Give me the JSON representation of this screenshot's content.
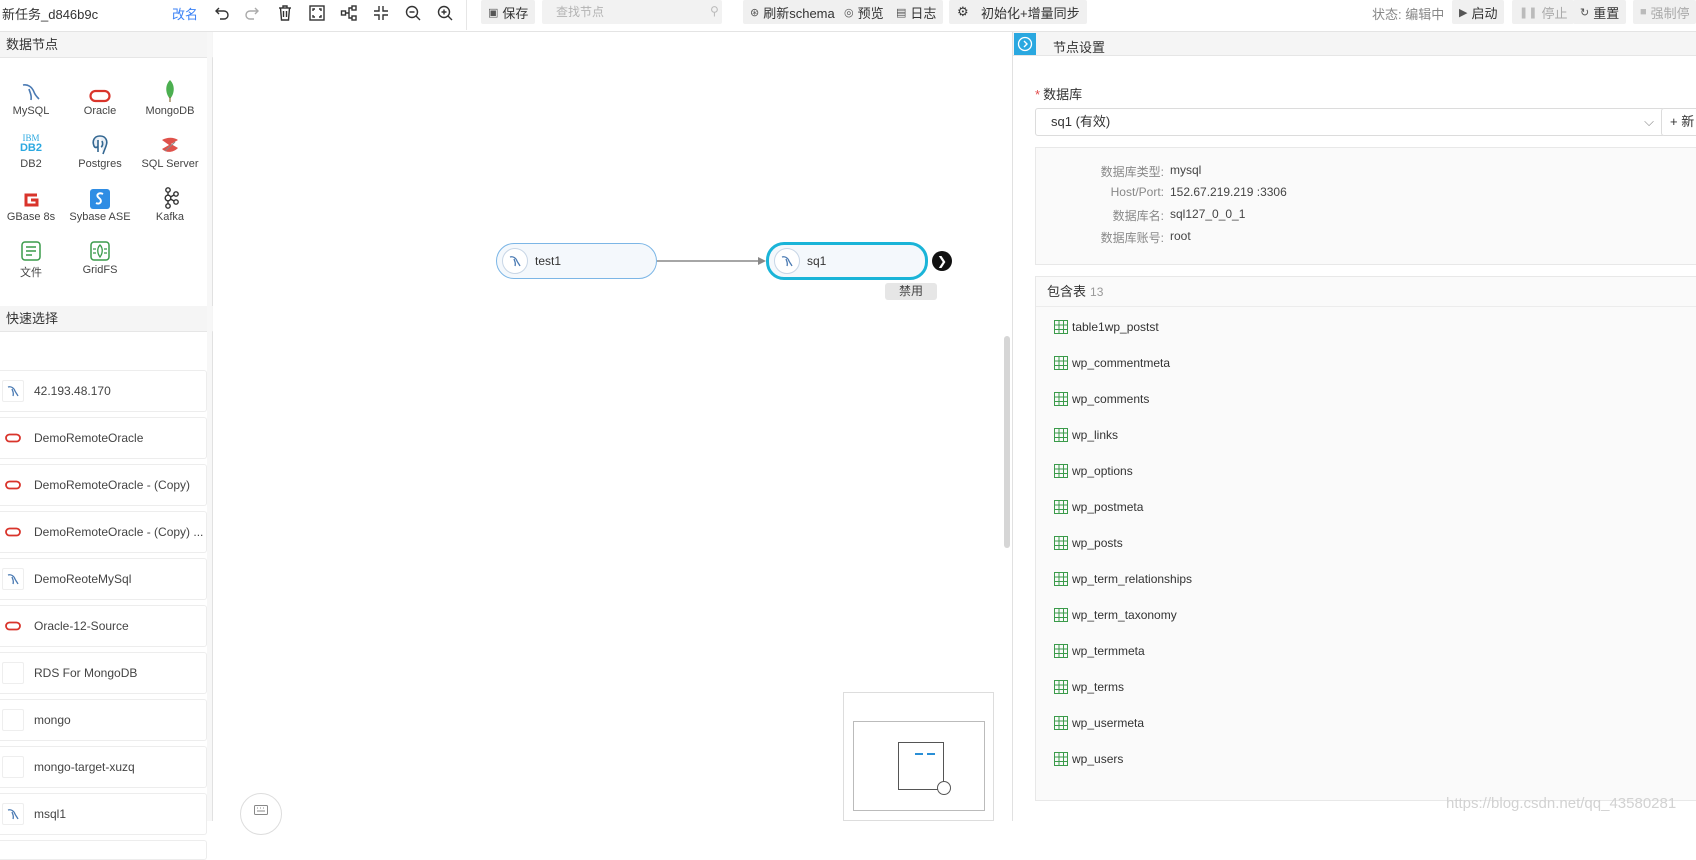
{
  "toolbar": {
    "title": "新任务_d846b9c",
    "rename": "改名",
    "save": "保存",
    "search_placeholder": "查找节点",
    "refresh_schema": "刷新schema",
    "preview": "预览",
    "log": "日志",
    "sync_mode": "初始化+增量同步",
    "status": "状态: 编辑中",
    "start": "启动",
    "stop": "停止",
    "reset": "重置",
    "force_stop": "强制停"
  },
  "left_panel": {
    "data_nodes_title": "数据节点",
    "data_nodes": [
      {
        "label": "MySQL",
        "icon": "mysql-icon"
      },
      {
        "label": "Oracle",
        "icon": "oracle-icon"
      },
      {
        "label": "MongoDB",
        "icon": "mongodb-icon"
      },
      {
        "label": "DB2",
        "icon": "db2-icon"
      },
      {
        "label": "Postgres",
        "icon": "postgres-icon"
      },
      {
        "label": "SQL Server",
        "icon": "sqlserver-icon"
      },
      {
        "label": "GBase 8s",
        "icon": "gbase-icon"
      },
      {
        "label": "Sybase ASE",
        "icon": "sybase-icon"
      },
      {
        "label": "Kafka",
        "icon": "kafka-icon"
      },
      {
        "label": "文件",
        "icon": "file-icon"
      },
      {
        "label": "GridFS",
        "icon": "gridfs-icon"
      }
    ],
    "quick_select_title": "快速选择",
    "quick_items": [
      {
        "label": "42.193.48.170",
        "icon": "mysql-icon"
      },
      {
        "label": "DemoRemoteOracle",
        "icon": "oracle-icon"
      },
      {
        "label": "DemoRemoteOracle - (Copy)",
        "icon": "oracle-icon"
      },
      {
        "label": "DemoRemoteOracle - (Copy) ...",
        "icon": "oracle-icon"
      },
      {
        "label": "DemoReoteMySql",
        "icon": "mysql-icon"
      },
      {
        "label": "Oracle-12-Source",
        "icon": "oracle-icon"
      },
      {
        "label": "RDS For MongoDB",
        "icon": "blank-icon"
      },
      {
        "label": "mongo",
        "icon": "blank-icon"
      },
      {
        "label": "mongo-target-xuzq",
        "icon": "blank-icon"
      },
      {
        "label": "msql1",
        "icon": "mysql-icon"
      }
    ]
  },
  "canvas": {
    "source_node": "test1",
    "target_node": "sq1",
    "target_badge": "禁用"
  },
  "right_panel": {
    "title": "节点设置",
    "db_label": "数据库",
    "db_required": "*",
    "db_value": "sq1 (有效)",
    "new_button": "+ 新",
    "info": [
      {
        "key": "数据库类型:",
        "value": "mysql"
      },
      {
        "key": "Host/Port:",
        "value": "152.67.219.219 :3306"
      },
      {
        "key": "数据库名:",
        "value": "sql127_0_0_1"
      },
      {
        "key": "数据库账号:",
        "value": "root"
      }
    ],
    "tables_title": "包含表",
    "tables_count": "13",
    "tables": [
      "table1wp_postst",
      "wp_commentmeta",
      "wp_comments",
      "wp_links",
      "wp_options",
      "wp_postmeta",
      "wp_posts",
      "wp_term_relationships",
      "wp_term_taxonomy",
      "wp_termmeta",
      "wp_terms",
      "wp_usermeta",
      "wp_users"
    ]
  },
  "watermark": "https://blog.csdn.net/qq_43580281",
  "colors": {
    "accent": "#2aa8e0",
    "node_border_source": "#7cb6e6",
    "node_border_target": "#1ab4d8",
    "table_icon": "#3a9b4a",
    "oracle_red": "#d9342b",
    "mongo_green": "#4caf50"
  }
}
